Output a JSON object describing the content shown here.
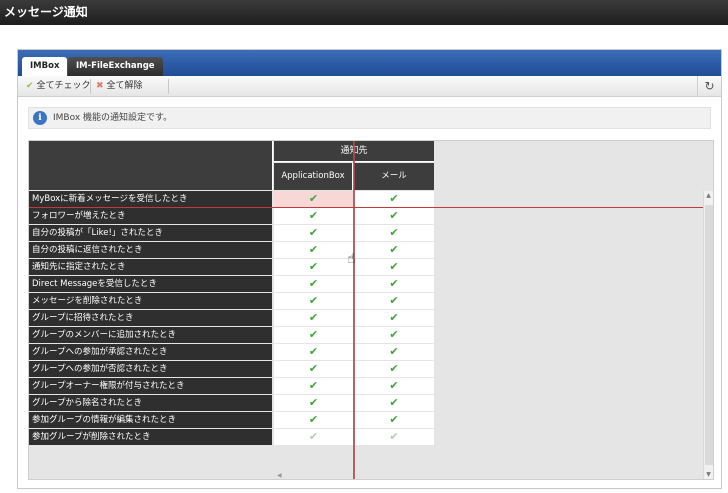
{
  "title": "メッセージ通知",
  "tabs": [
    {
      "label": "IMBox",
      "active": true
    },
    {
      "label": "IM-FileExchange",
      "active": false
    }
  ],
  "toolbar": {
    "check_all": "全てチェック",
    "clear_all": "全て解除",
    "refresh_icon": "refresh-icon"
  },
  "info": {
    "text": "IMBox 機能の通知設定です。",
    "icon": "info-icon"
  },
  "grid": {
    "group_header": "通知先",
    "columns": [
      "ApplicationBox",
      "メール"
    ],
    "rows": [
      {
        "label": "MyBoxに新着メッセージを受信したとき",
        "app": "✔",
        "mail": "✔"
      },
      {
        "label": "フォロワーが増えたとき",
        "app": "✔",
        "mail": "✔"
      },
      {
        "label": "自分の投稿が「Like!」されたとき",
        "app": "✔",
        "mail": "✔"
      },
      {
        "label": "自分の投稿に返信されたとき",
        "app": "✔",
        "mail": "✔"
      },
      {
        "label": "通知先に指定されたとき",
        "app": "✔",
        "mail": "✔"
      },
      {
        "label": "Direct Messageを受信したとき",
        "app": "✔",
        "mail": "✔"
      },
      {
        "label": "メッセージを削除されたとき",
        "app": "✔",
        "mail": "✔"
      },
      {
        "label": "グループに招待されたとき",
        "app": "✔",
        "mail": "✔"
      },
      {
        "label": "グループのメンバーに追加されたとき",
        "app": "✔",
        "mail": "✔"
      },
      {
        "label": "グループへの参加が承認されたとき",
        "app": "✔",
        "mail": "✔"
      },
      {
        "label": "グループへの参加が否認されたとき",
        "app": "✔",
        "mail": "✔"
      },
      {
        "label": "グループオーナー権限が付与されたとき",
        "app": "✔",
        "mail": "✔"
      },
      {
        "label": "グループから除名されたとき",
        "app": "✔",
        "mail": "✔"
      },
      {
        "label": "参加グループの情報が編集されたとき",
        "app": "✔",
        "mail": "✔"
      },
      {
        "label": "参加グループが削除されたとき",
        "app": "✔",
        "mail": "✔"
      }
    ]
  },
  "colors": {
    "tab_bar": "#1f4d96",
    "check": "#3ea637",
    "highlight": "#f8d7d7",
    "guide_line": "#c23b3b"
  }
}
